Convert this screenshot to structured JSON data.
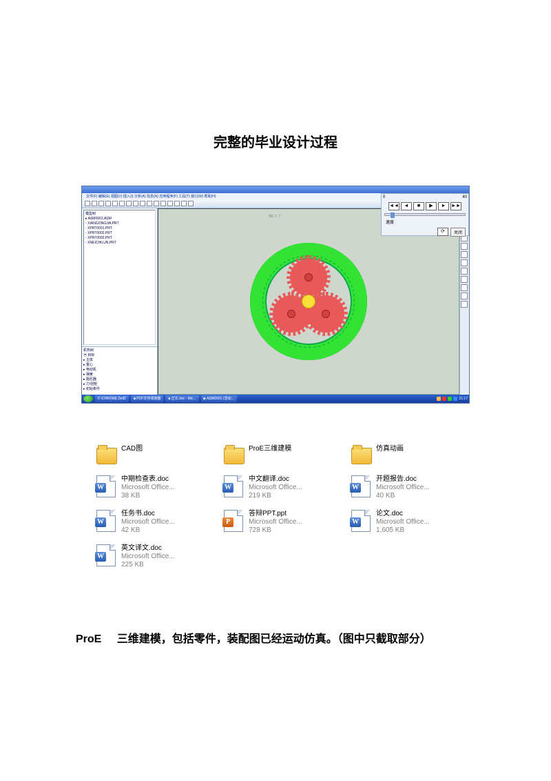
{
  "page_title": "完整的毕业设计过程",
  "proe": {
    "menu_items": "文件(F)  编辑(E)  视图(V)  插入(I)  分析(A)  信息(N)  应用程序(P)  工具(T)  窗口(W)  帮助(H)",
    "canvas_label": "MC  1 .7",
    "tree_title": "模型树",
    "tree_items": [
      "▸ ASM0001.ASM",
      "  ▫ XIANGONGJIA.PRT",
      "  ▫ XPRT0001.PRT",
      "  ▫ XPRT0002.PRT",
      "  ▫ XPRT0002.PRT",
      "  ▫ XNEICHILUN.PRT"
    ],
    "mech_title": "机构树",
    "mech_items": [
      "▣ 目标",
      " ▸ 主体",
      " ▸ 重心",
      " ▸ 电动机",
      " ▸ 弹簧",
      " ▸ 阻尼器",
      " ▸ 力/扭矩",
      " ▸ 初始条件"
    ],
    "player": {
      "val_left": "0",
      "val_right": "40",
      "speed_label": "速度",
      "close_btn": "关闭"
    },
    "taskbar_items": [
      "",
      "F:\\CHROME.Dell2",
      "■ PDF文件阅读器",
      "■ 正文.doc - Mic...",
      "▶ ASM0001 (活动..."
    ],
    "taskbar_time": "21:17"
  },
  "files": [
    {
      "type": "folder",
      "name": "CAD图",
      "meta1": "",
      "meta2": ""
    },
    {
      "type": "folder",
      "name": "ProE三维建模",
      "meta1": "",
      "meta2": ""
    },
    {
      "type": "folder",
      "name": "仿真动画",
      "meta1": "",
      "meta2": ""
    },
    {
      "type": "word",
      "name": "中期检查表.doc",
      "meta1": "Microsoft Office...",
      "meta2": "38 KB"
    },
    {
      "type": "word",
      "name": "中文翻译.doc",
      "meta1": "Microsoft Office...",
      "meta2": "219 KB"
    },
    {
      "type": "word",
      "name": "开题报告.doc",
      "meta1": "Microsoft Office...",
      "meta2": "40 KB"
    },
    {
      "type": "word",
      "name": "任务书.doc",
      "meta1": "Microsoft Office...",
      "meta2": "42 KB"
    },
    {
      "type": "ppt",
      "name": "答辩PPT.ppt",
      "meta1": "Microsoft Office...",
      "meta2": "728 KB"
    },
    {
      "type": "word",
      "name": "论文.doc",
      "meta1": "Microsoft Office...",
      "meta2": "1,605 KB"
    },
    {
      "type": "word",
      "name": "英文译文.doc",
      "meta1": "Microsoft Office...",
      "meta2": "225 KB"
    }
  ],
  "body_text_1": "ProE",
  "body_text_2": "三维建模，包括零件，装配图已经运动仿真。（图中只截取部分）"
}
